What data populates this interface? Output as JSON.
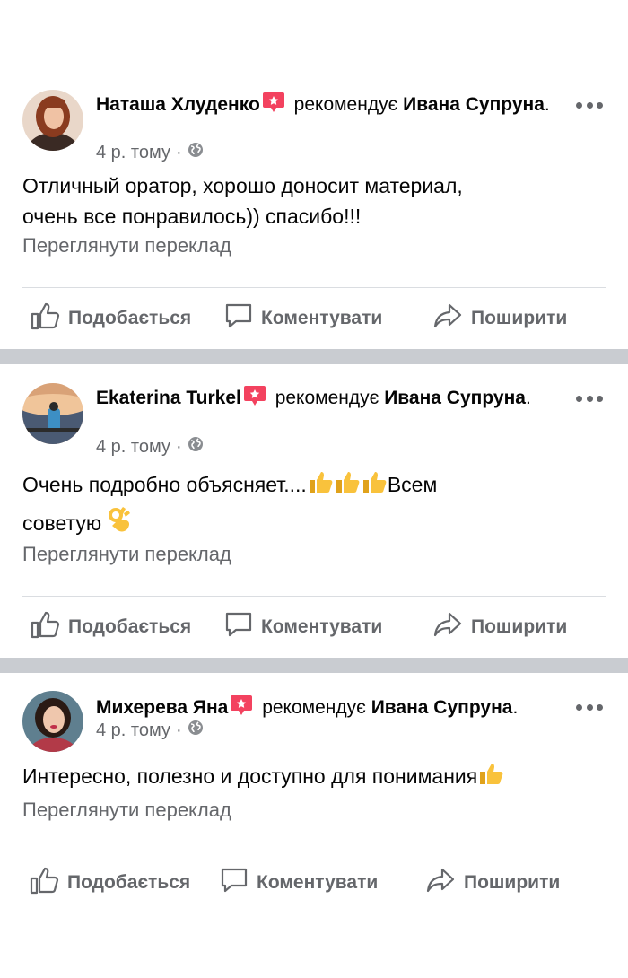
{
  "posts": [
    {
      "author": "Наташа Хлуденко",
      "recommends_label": "рекомендує",
      "target": "Ивана Супруна",
      "target_suffix": ".",
      "time": "4 р. тому",
      "dot": "·",
      "text_line1": "Отличный оратор, хорошо доносит материал,",
      "text_line2": "очень все понравилось)) спасибо!!!",
      "translate": "Переглянути переклад"
    },
    {
      "author": "Ekaterina Turkel",
      "recommends_label": "рекомендує",
      "target": "Ивана Супруна",
      "target_suffix": ".",
      "time": "4 р. тому",
      "dot": "·",
      "text_line1": "Очень подробно объясняет....",
      "text_line1_end": "Всем",
      "text_line2": "советую",
      "translate": "Переглянути переклад"
    },
    {
      "author": "Михерева Яна",
      "recommends_label": "рекомендує",
      "target": "Ивана Супруна",
      "target_suffix": ".",
      "time": "4 р. тому",
      "dot": "·",
      "text_line1": "Интересно, полезно и доступно для понимания",
      "translate": "Переглянути переклад"
    }
  ],
  "actions": {
    "like": "Подобається",
    "comment": "Коментувати",
    "share": "Поширити"
  },
  "icons": [
    "recommend-badge-icon",
    "globe-icon",
    "more-options-icon",
    "like-icon",
    "comment-icon",
    "share-icon",
    "thumbs-up-emoji-icon",
    "ok-hand-emoji-icon"
  ],
  "colors": {
    "badge": "#f3425f",
    "secondary_text": "#65676b",
    "separator": "#c9ccd1"
  }
}
